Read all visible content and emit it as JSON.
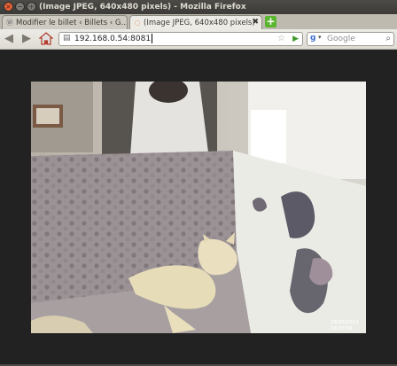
{
  "window": {
    "title": "(Image JPEG, 640x480 pixels) - Mozilla Firefox",
    "controls": {
      "close": "×",
      "minimize": "−",
      "maximize": "+"
    }
  },
  "tabs": [
    {
      "label": "Modifier le billet ‹ Billets ‹ G...",
      "icon": "wordpress-icon",
      "active": false
    },
    {
      "label": "(Image JPEG, 640x480 pixels)",
      "icon": "firefox-loading-icon",
      "active": true,
      "close": "✖"
    }
  ],
  "new_tab": "+",
  "navbar": {
    "back": "◀",
    "forward": "▶",
    "home": "⌂",
    "url": "192.168.0.54:8081",
    "star": "☆",
    "go": "▶"
  },
  "search": {
    "engine_letter": "g",
    "dropdown": "▾",
    "placeholder": "Google",
    "button": "⌕"
  },
  "image": {
    "description_alt": "",
    "timestamp_overlay": [
      "28/08/2012",
      "18:33:58"
    ]
  },
  "colors": {
    "accent_green": "#5cb531",
    "titlebar": "#3c3b37",
    "close_orange": "#e8653a"
  }
}
